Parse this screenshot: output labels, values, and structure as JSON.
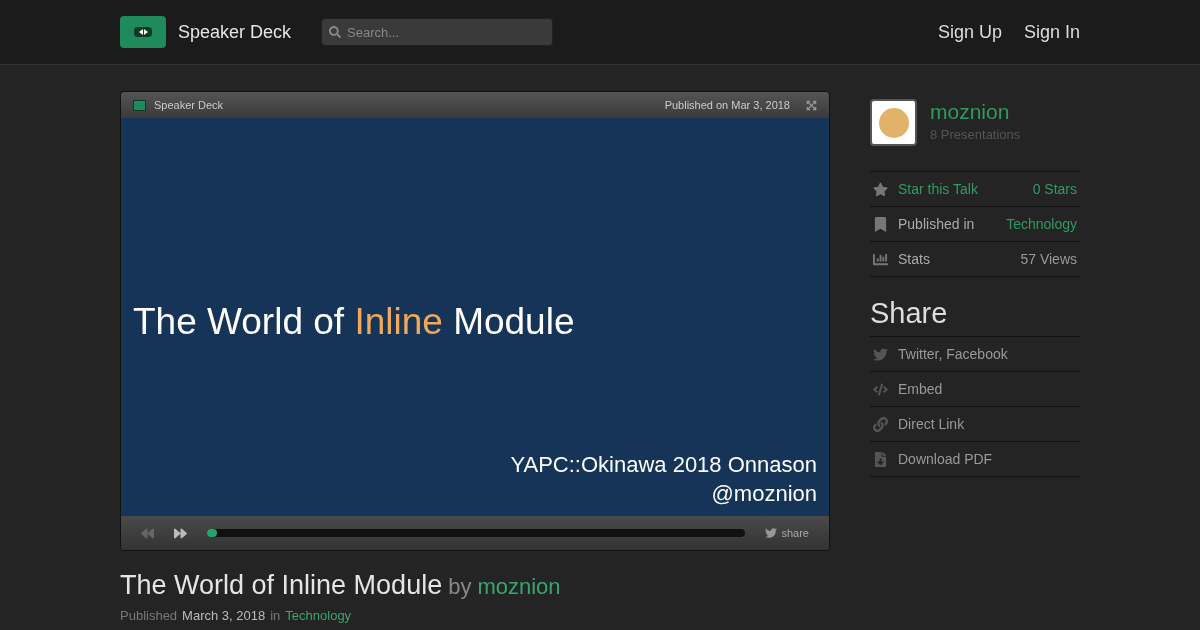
{
  "header": {
    "brand": "Speaker Deck",
    "search": {
      "placeholder": "Search..."
    },
    "nav": [
      "Sign Up",
      "Sign In"
    ]
  },
  "player": {
    "brand": "Speaker Deck",
    "published": "Published on Mar 3, 2018",
    "slide": {
      "title_parts": [
        {
          "text": "The World of ",
          "highlight": false
        },
        {
          "text": "Inline",
          "highlight": true
        },
        {
          "text": " Module",
          "highlight": false
        }
      ],
      "subtitle_lines": [
        "YAPC::Okinawa 2018 Onnason",
        "@moznion"
      ]
    },
    "progress": {
      "level": 0.012
    },
    "share": "share"
  },
  "talk": {
    "title": "The World of Inline Module",
    "by": "by",
    "author": "moznion",
    "published_label": "Published",
    "date": "March 3, 2018",
    "in": "in",
    "category": "Technology"
  },
  "sidebar": {
    "author": "moznion",
    "presentations": "8 Presentations",
    "meta": [
      {
        "kind": "star",
        "label": "Star this Talk",
        "value": "0 Stars",
        "label_is_link": true,
        "value_is_link": true
      },
      {
        "kind": "bookmark",
        "label": "Published in",
        "value": "Technology",
        "label_is_link": false,
        "value_is_link": true
      },
      {
        "kind": "stats",
        "label": "Stats",
        "value": "57 Views",
        "label_is_link": false,
        "value_is_link": false
      }
    ],
    "share_title": "Share",
    "share": [
      {
        "kind": "twitter",
        "label": "Twitter, Facebook"
      },
      {
        "kind": "code",
        "label": "Embed"
      },
      {
        "kind": "link",
        "label": "Direct Link"
      },
      {
        "kind": "download",
        "label": "Download PDF"
      }
    ]
  }
}
